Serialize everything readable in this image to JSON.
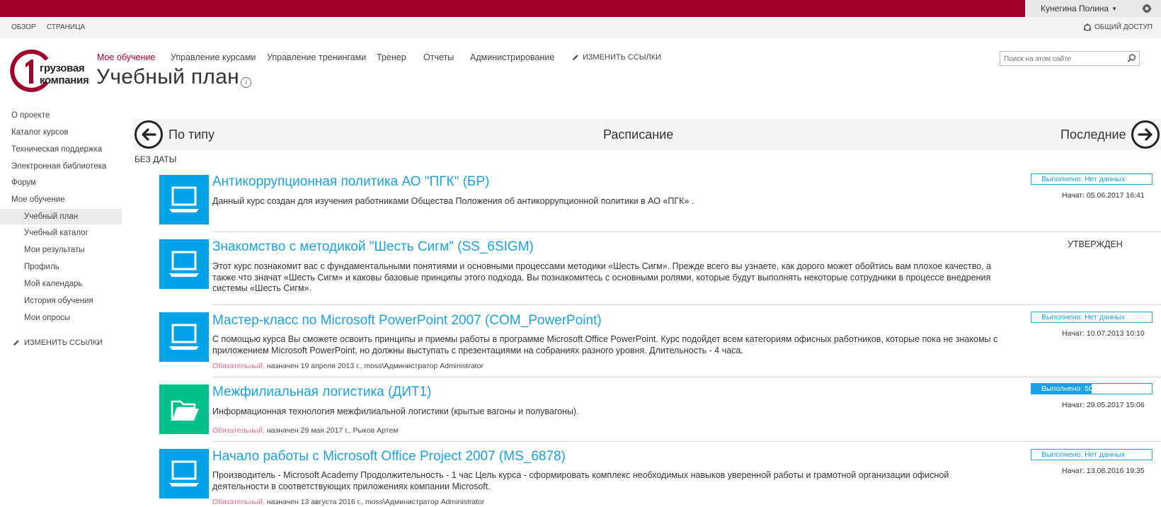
{
  "suitebar": {
    "user_name": "Кунегина Полина"
  },
  "ribbon": {
    "tab_overview": "ОБЗОР",
    "tab_page": "СТРАНИЦА",
    "share": "ОБЩИЙ ДОСТУП"
  },
  "logo": {
    "line1": "грузовая",
    "line2": "компания"
  },
  "topnav": {
    "items": [
      "Мое обучение",
      "Управление курсами",
      "Управление тренингами",
      "Тренер",
      "Отчеты",
      "Администрирование"
    ],
    "edit_links": "ИЗМЕНИТЬ ССЫЛКИ"
  },
  "page": {
    "title": "Учебный план"
  },
  "search": {
    "placeholder": "Поиск на этом сайте"
  },
  "leftnav": {
    "items": [
      "О проекте",
      "Каталог курсов",
      "Техническая поддержка",
      "Электронная библиотека",
      "Форум",
      "Мое обучение"
    ],
    "subitems": [
      "Учебный план",
      "Учебный каталог",
      "Мои результаты",
      "Профиль",
      "Мой календарь",
      "История обучения",
      "Мои опросы"
    ],
    "edit_links": "ИЗМЕНИТЬ ССЫЛКИ"
  },
  "sort": {
    "by_type": "По типу",
    "schedule": "Расписание",
    "recent": "Последние"
  },
  "group": {
    "no_date": "БЕЗ ДАТЫ"
  },
  "courses": [
    {
      "title": "Антикоррупционная политика АО \"ПГК\" (БР)",
      "desc": "Данный курс создан для изучения работниками Общества Положения об антикоррупционной политики в АО «ПГК» .",
      "status": "Выполнено:  Нет данных",
      "progress": 0,
      "start": "Начат:  05.06.2017 16:41",
      "thumb_color": "#00a2e8",
      "icon": "laptop-icon"
    },
    {
      "title": "Знакомство с методикой \"Шесть Сигм\" (SS_6SIGM)",
      "desc": "Этот курс познакомит вас с фундаментальными понятиями и основными процессами методики «Шесть Сигм». Прежде всего вы узнаете, как дорого может обойтись вам плохое качество, а также что значат «Шесть Сигм» и каковы базовые принципы этого подхода. Вы познакомитесь с основными ролями, которые будут выполнять некоторые сотрудники в процессе внедрения системы «Шесть Сигм».",
      "approved": "УТВЕРЖДЕН",
      "thumb_color": "#00a2e8",
      "icon": "laptop-icon"
    },
    {
      "title": "Мастер-класс по Microsoft PowerPoint 2007 (COM_PowerPoint)",
      "desc": "С помощью курса Вы сможете освоить принципы и приемы работы в программе Microsoft Office PowerPoint. Курс подойдет всем категориям офисных работников, которые пока не знакомы с приложением Microsoft PowerPoint, но должны выступать с презентациями на собраниях разного уровня. Длительность - 4 часа.",
      "required": "Обязательный,",
      "assigned": " назначен 19 апреля 2013 г., moss\\Администратор Administrator",
      "status": "Выполнено:  Нет данных",
      "progress": 0,
      "start": "Начат:  10.07.2013 10:10",
      "thumb_color": "#00a2e8",
      "icon": "laptop-icon"
    },
    {
      "title": "Межфилиальная логистика (ДИТ1)",
      "desc": "Информационная технология межфилиальной логистики (крытые вагоны и полувагоны).",
      "required": "Обязательный,",
      "assigned": " назначен 29 мая 2017 г., Рыков Артем",
      "status": "Выполнено:  50%",
      "progress": 50,
      "start": "Начат:  29.05.2017 15:06",
      "thumb_color": "#00c08b",
      "icon": "folder-icon"
    },
    {
      "title": "Начало работы с Microsoft Office Project 2007 (MS_6878)",
      "desc": "Производитель - Microsoft Academy Продолжительность - 1 час Цель курса - сформировать комплекс необходимых навыков уверенной работы и грамотной организации офисной деятельности в соответствующих приложениях компании Microsoft.",
      "required": "Обязательный,",
      "assigned": " назначен 13 августа 2016 г., moss\\Администратор Administrator",
      "status": "Выполнено:  Нет данных",
      "progress": 0,
      "start": "Начат:  13.08.2016 19:35",
      "thumb_color": "#00a2e8",
      "icon": "laptop-icon"
    }
  ]
}
